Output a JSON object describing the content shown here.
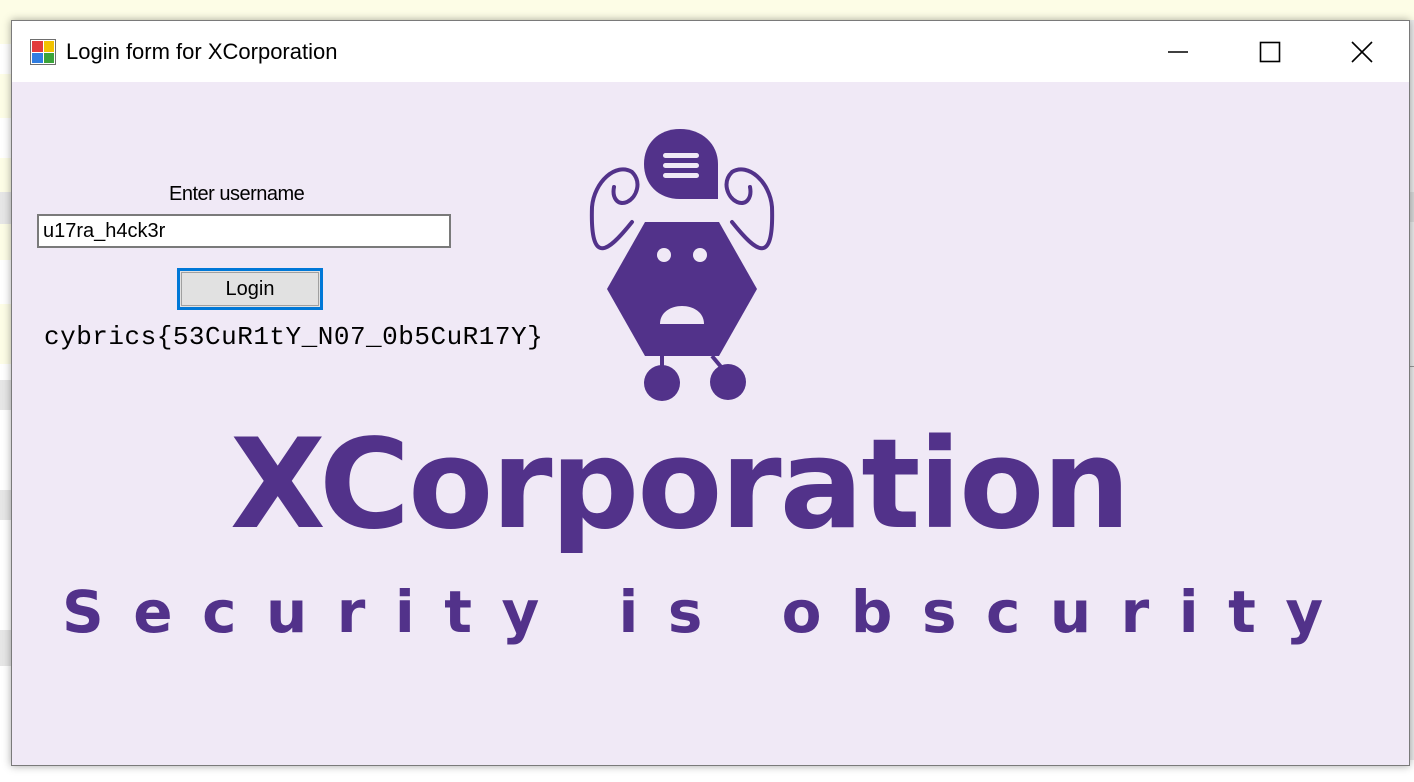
{
  "window": {
    "title": "Login form for XCorporation",
    "buttons": {
      "minimize": "minimize-icon",
      "maximize": "maximize-icon",
      "close": "close-icon"
    }
  },
  "form": {
    "username_label": "Enter username",
    "username_value": "u17ra_h4ck3r",
    "login_label": "Login",
    "flag": "cybrics{53CuR1tY_N07_0b5CuR17Y}"
  },
  "branding": {
    "name": "XCorporation",
    "tagline": "Security is obscurity",
    "logo_icon": "robot-icon"
  },
  "colors": {
    "brand_purple": "#52328a",
    "client_background": "#f0e9f6",
    "focus_border": "#0078d7"
  }
}
